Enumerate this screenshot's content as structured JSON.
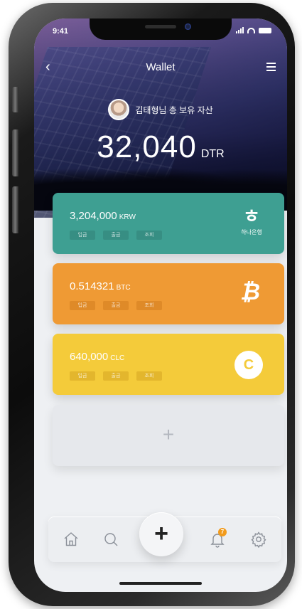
{
  "status_bar": {
    "time": "9:41"
  },
  "header": {
    "back_icon": "chevron-left-icon",
    "title": "Wallet",
    "menu_icon": "hamburger-menu-icon"
  },
  "user": {
    "label": "김태형님 총 보유 자산"
  },
  "total": {
    "amount": "32,040",
    "unit": "DTR"
  },
  "cards": [
    {
      "balance": "3,204,000",
      "currency": "KRW",
      "actions": [
        "입금",
        "출금",
        "조회"
      ],
      "logo_icon": "hana-bank-logo",
      "logo_text": "하나은행",
      "color": "#3e9f92"
    },
    {
      "balance": "0.514321",
      "currency": "BTC",
      "actions": [
        "입금",
        "출금",
        "조회"
      ],
      "logo_icon": "bitcoin-icon",
      "logo_glyph": "₿",
      "color": "#ef9a34"
    },
    {
      "balance": "640,000",
      "currency": "CLC",
      "actions": [
        "입금",
        "출금",
        "조회"
      ],
      "logo_icon": "clc-coin-icon",
      "logo_glyph": "C",
      "color": "#f4cb3a"
    }
  ],
  "add_card": {
    "glyph": "+"
  },
  "tab_bar": {
    "items": [
      "home-icon",
      "search-icon",
      "add-icon",
      "bell-icon",
      "gear-icon"
    ],
    "fab_glyph": "+",
    "notification_badge": "7",
    "badge_color": "#f29b1c"
  }
}
